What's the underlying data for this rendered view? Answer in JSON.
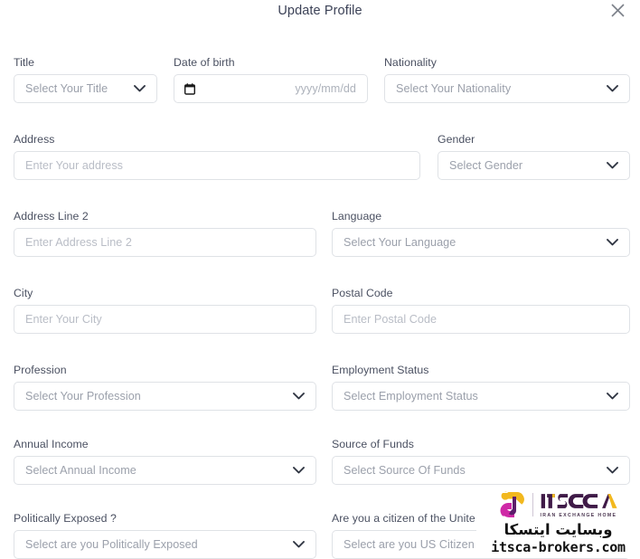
{
  "modal": {
    "title": "Update Profile",
    "close_icon": "close-icon"
  },
  "fields": {
    "title": {
      "label": "Title",
      "placeholder": "Select Your Title",
      "type": "select"
    },
    "date_of_birth": {
      "label": "Date of birth",
      "placeholder": "yyyy/mm/dd",
      "type": "date"
    },
    "nationality": {
      "label": "Nationality",
      "placeholder": "Select Your Nationality",
      "type": "select"
    },
    "address": {
      "label": "Address",
      "placeholder": "Enter Your address",
      "type": "text"
    },
    "gender": {
      "label": "Gender",
      "placeholder": "Select Gender",
      "type": "select"
    },
    "address_line_2": {
      "label": "Address Line 2",
      "placeholder": "Enter Address Line 2",
      "type": "text"
    },
    "language": {
      "label": "Language",
      "placeholder": "Select Your Language",
      "type": "select"
    },
    "city": {
      "label": "City",
      "placeholder": "Enter Your City",
      "type": "text"
    },
    "postal_code": {
      "label": "Postal Code",
      "placeholder": "Enter Postal Code",
      "type": "text"
    },
    "profession": {
      "label": "Profession",
      "placeholder": "Select Your Profession",
      "type": "select"
    },
    "employment_status": {
      "label": "Employment Status",
      "placeholder": "Select Employment Status",
      "type": "select"
    },
    "annual_income": {
      "label": "Annual Income",
      "placeholder": "Select Annual Income",
      "type": "select"
    },
    "source_of_funds": {
      "label": "Source of Funds",
      "placeholder": "Select Source Of Funds",
      "type": "select"
    },
    "politically_exposed": {
      "label": "Politically Exposed ?",
      "placeholder": "Select are you Politically Exposed",
      "type": "select"
    },
    "us_citizen": {
      "label": "Are you a citizen of the Unite",
      "placeholder": "Select are you US Citizen",
      "type": "select"
    }
  },
  "watermark": {
    "brand": "ITSCA",
    "tagline": "IRAN EXCHANGE HOME",
    "persian_text": "وبسایت ایتسکا",
    "url": "itsca-brokers.com",
    "colors": {
      "brand_purple": "#3f1a47",
      "accent_yellow": "#f2b81e",
      "accent_magenta": "#cf29a6",
      "accent_violet": "#8a2be2"
    }
  },
  "colors": {
    "title_text": "#3c4257",
    "label_text": "#4a5061",
    "placeholder_text": "#b9bdc6",
    "border": "#dfe2e6",
    "background": "#ffffff"
  }
}
